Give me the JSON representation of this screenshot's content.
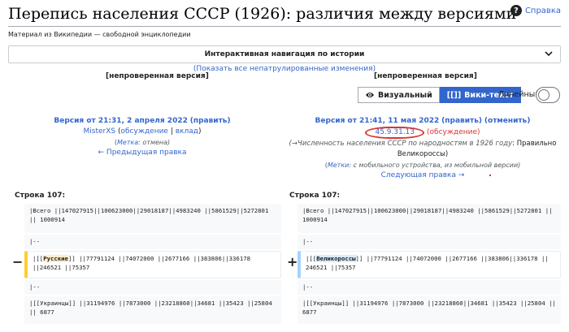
{
  "page": {
    "title": "Перепись населения СССР (1926): различия между версиями",
    "help_label": "Справка",
    "subtitle": "Материал из Википедии — свободной энциклопедии",
    "nav_bar_label": "Интерактивная навигация по истории",
    "show_all_link": "(Показать все непатрулированные изменения)"
  },
  "unverified_label": "[непроверенная версия]",
  "toolbar": {
    "visual_label": "Визуальный",
    "wikitext_label": "Вики-текст",
    "wikitext_icon": "[[]]",
    "linear_label": "Линейный"
  },
  "left": {
    "version_link": "Версия от 21:31, 2 апреля 2022",
    "edit_label": "(править)",
    "user": "MisterXS",
    "user_links_open": "(",
    "talk_link": "обсуждение",
    "contrib_link": "вклад",
    "user_links_close": ")",
    "tag_prefix": "(",
    "tag_label": "Метка",
    "tag_value": ": отмена)",
    "prev_edit": "← Предыдущая правка",
    "line_label": "Строка 107:"
  },
  "right": {
    "version_link": "Версия от 21:41, 11 мая 2022",
    "edit_label": "(править)",
    "undo_label": "(отменить)",
    "user_ip": "45.9.31.13",
    "talk_link": "(обсуждение)",
    "summary_arrow": "(→",
    "summary_section": "Численность населения СССР по народностям в 1926 году",
    "summary_text": ": Правильно Великороссы)",
    "tags_prefix": "(",
    "tags_label": "Метки",
    "tags_value": ": с мобильного устройства, из мобильной версии)",
    "next_edit": "Следующая правка →",
    "line_label": "Строка 107:"
  },
  "diff": {
    "row1": "|Всего ||147027915||100623000||29018187||4983240 ||5861529||5272801 || 1000914",
    "row2": "|--",
    "left_row3_pre": "|[[",
    "left_row3_word": "Русские",
    "left_row3_post": "]] ||77791124 ||74072000 ||2677166 ||383806||336178 ||246521 ||75357",
    "right_row3_pre": "|[[",
    "right_row3_word": "Великороссы",
    "right_row3_post": "]] ||77791124 ||74072000 ||2677166 ||383806||336178 || 246521 ||75357",
    "row4": "|--",
    "row5": "|[[Украинцы]] ||31194976 ||7873000 ||23218860||34681 ||35423 ||25804 || 6877",
    "minus_marker": "−",
    "plus_marker": "+"
  },
  "colors": {
    "link": "#3366cc",
    "accent": "#3366cc",
    "deleted_border": "#ffcc33",
    "added_border": "#a3d3ff",
    "annotation_red": "#dd3333"
  }
}
